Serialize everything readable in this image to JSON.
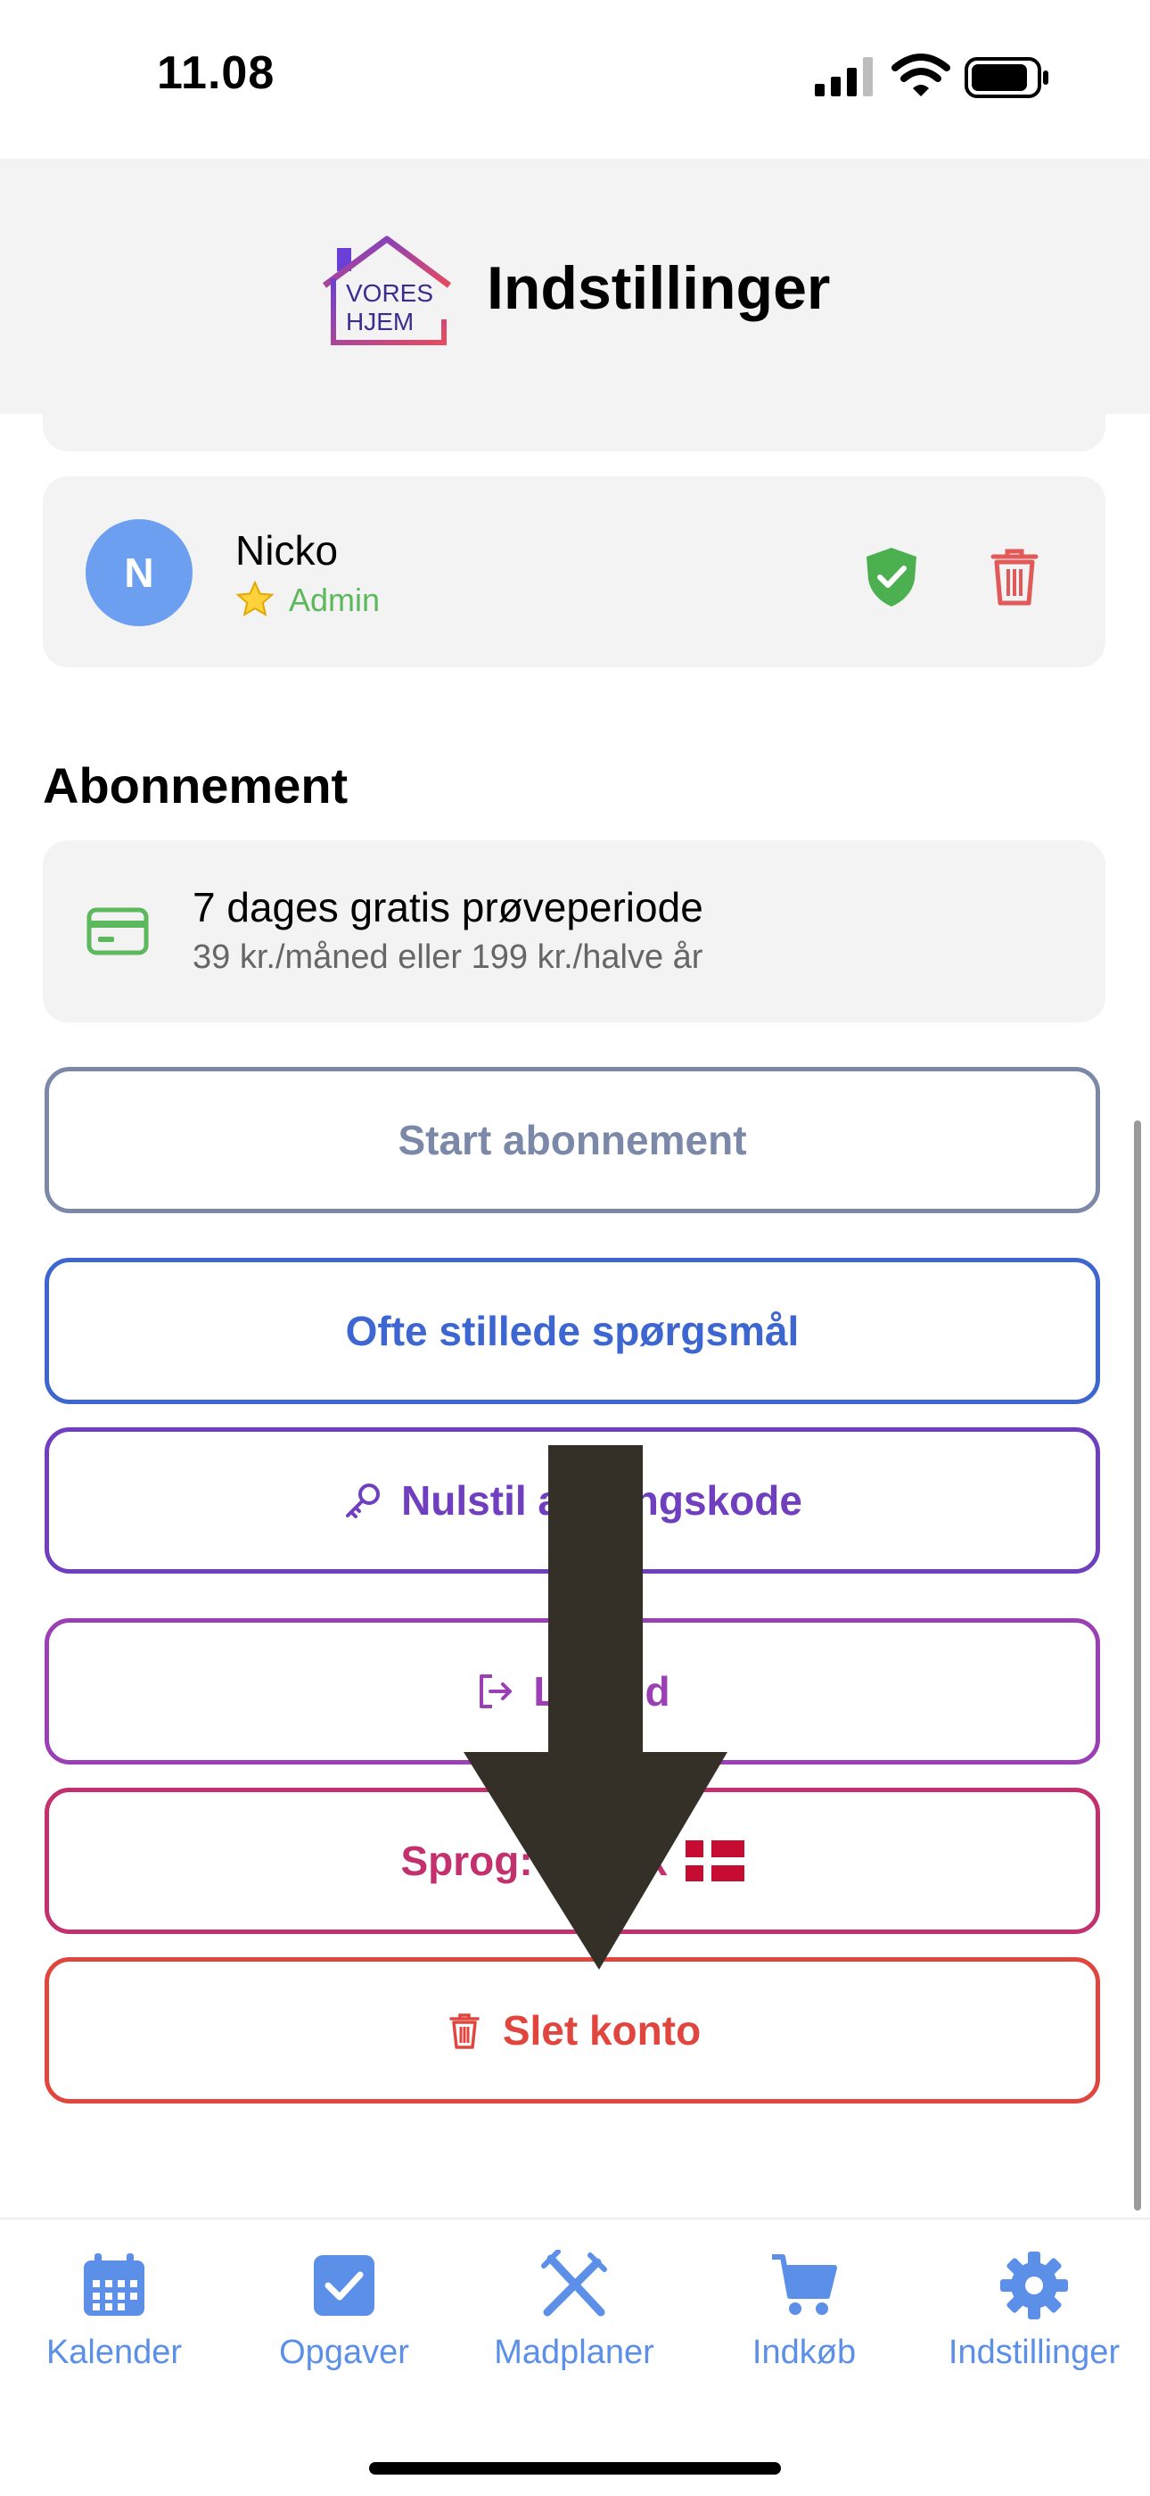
{
  "status_bar": {
    "time": "11.08"
  },
  "header": {
    "logo_text_line1": "VORES",
    "logo_text_line2": "HJEM",
    "title": "Indstillinger"
  },
  "member": {
    "avatar_initial": "N",
    "name": "Nicko",
    "role": "Admin"
  },
  "subscription": {
    "heading": "Abonnement",
    "title": "7 dages gratis prøveperiode",
    "detail": "39 kr./måned eller 199 kr./halve år"
  },
  "buttons": {
    "start_subscription": "Start abonnement",
    "faq": "Ofte stillede spørgsmål",
    "reset_password": "Nulstil adgangskode",
    "logout": "Log ud",
    "language": "Sprog: Dansk",
    "delete_account": "Slet konto"
  },
  "tabs": [
    {
      "label": "Kalender",
      "icon": "calendar-icon"
    },
    {
      "label": "Opgaver",
      "icon": "checkbox-icon"
    },
    {
      "label": "Madplaner",
      "icon": "utensils-icon"
    },
    {
      "label": "Indkøb",
      "icon": "cart-icon"
    },
    {
      "label": "Indstillinger",
      "icon": "gear-icon"
    }
  ],
  "colors": {
    "accent": "#5b8fe8",
    "admin": "#5cb85c",
    "danger": "#e0463e",
    "faq": "#3e66d0",
    "reset": "#6f3fbf",
    "logout": "#9a3fb4",
    "language": "#c2306e",
    "start_subscription": "#7b88a8"
  }
}
